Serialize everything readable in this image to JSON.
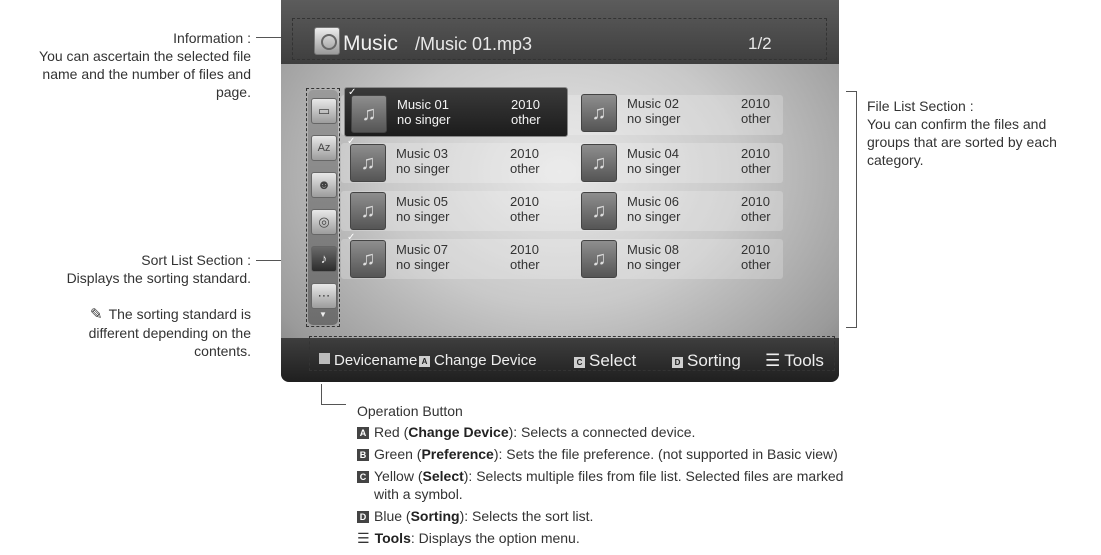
{
  "screen": {
    "title": "Music",
    "path": "/Music 01.mp3",
    "page": "1/2",
    "bottom": {
      "device": "Devicename",
      "btn_a": "A",
      "change_device": "Change Device",
      "btn_c": "C",
      "select": "Select",
      "btn_d": "D",
      "sorting": "Sorting",
      "tools": "Tools"
    },
    "sort_icons": [
      "folder-icon",
      "alphabet-sort-icon",
      "artist-icon",
      "album-icon",
      "genre-icon",
      "more-icon"
    ],
    "files": [
      {
        "name": "Music 01",
        "singer": "no singer",
        "year": "2010",
        "genre": "other",
        "checked": true,
        "selected": true
      },
      {
        "name": "Music 02",
        "singer": "no singer",
        "year": "2010",
        "genre": "other",
        "checked": false,
        "selected": false
      },
      {
        "name": "Music 03",
        "singer": "no singer",
        "year": "2010",
        "genre": "other",
        "checked": true,
        "selected": false
      },
      {
        "name": "Music 04",
        "singer": "no singer",
        "year": "2010",
        "genre": "other",
        "checked": false,
        "selected": false
      },
      {
        "name": "Music 05",
        "singer": "no singer",
        "year": "2010",
        "genre": "other",
        "checked": false,
        "selected": false
      },
      {
        "name": "Music 06",
        "singer": "no singer",
        "year": "2010",
        "genre": "other",
        "checked": false,
        "selected": false
      },
      {
        "name": "Music 07",
        "singer": "no singer",
        "year": "2010",
        "genre": "other",
        "checked": true,
        "selected": false
      },
      {
        "name": "Music 08",
        "singer": "no singer",
        "year": "2010",
        "genre": "other",
        "checked": false,
        "selected": false
      }
    ]
  },
  "callouts": {
    "information": {
      "title": "Information :",
      "lines": [
        "You can ascertain the selected file",
        "name and the number of files and",
        "page."
      ]
    },
    "sort_list": {
      "title": "Sort List Section :",
      "lines": [
        "Displays the sorting standard."
      ]
    },
    "note": {
      "lines": [
        "The sorting standard is",
        "different depending on the",
        "contents."
      ]
    },
    "file_list": {
      "title": "File List Section :",
      "lines": [
        "You can confirm the files and",
        "groups that are sorted by each",
        "category."
      ]
    }
  },
  "operation": {
    "title": "Operation Button",
    "red": {
      "key": "A",
      "pre": "Red (",
      "bold": "Change Device",
      "post": "): Selects a connected device."
    },
    "green": {
      "key": "B",
      "pre": "Green (",
      "bold": "Preference",
      "post": "): Sets the file preference. (not supported in Basic view)"
    },
    "yellow": {
      "key": "C",
      "pre": "Yellow (",
      "bold": "Select",
      "post": "): Selects multiple files from file list. Selected files are marked"
    },
    "yellow_cont": "with a symbol.",
    "blue": {
      "key": "D",
      "pre": "Blue (",
      "bold": "Sorting",
      "post": "): Selects the sort list."
    },
    "tools": {
      "bold": "Tools",
      "post": ": Displays the option menu."
    }
  }
}
